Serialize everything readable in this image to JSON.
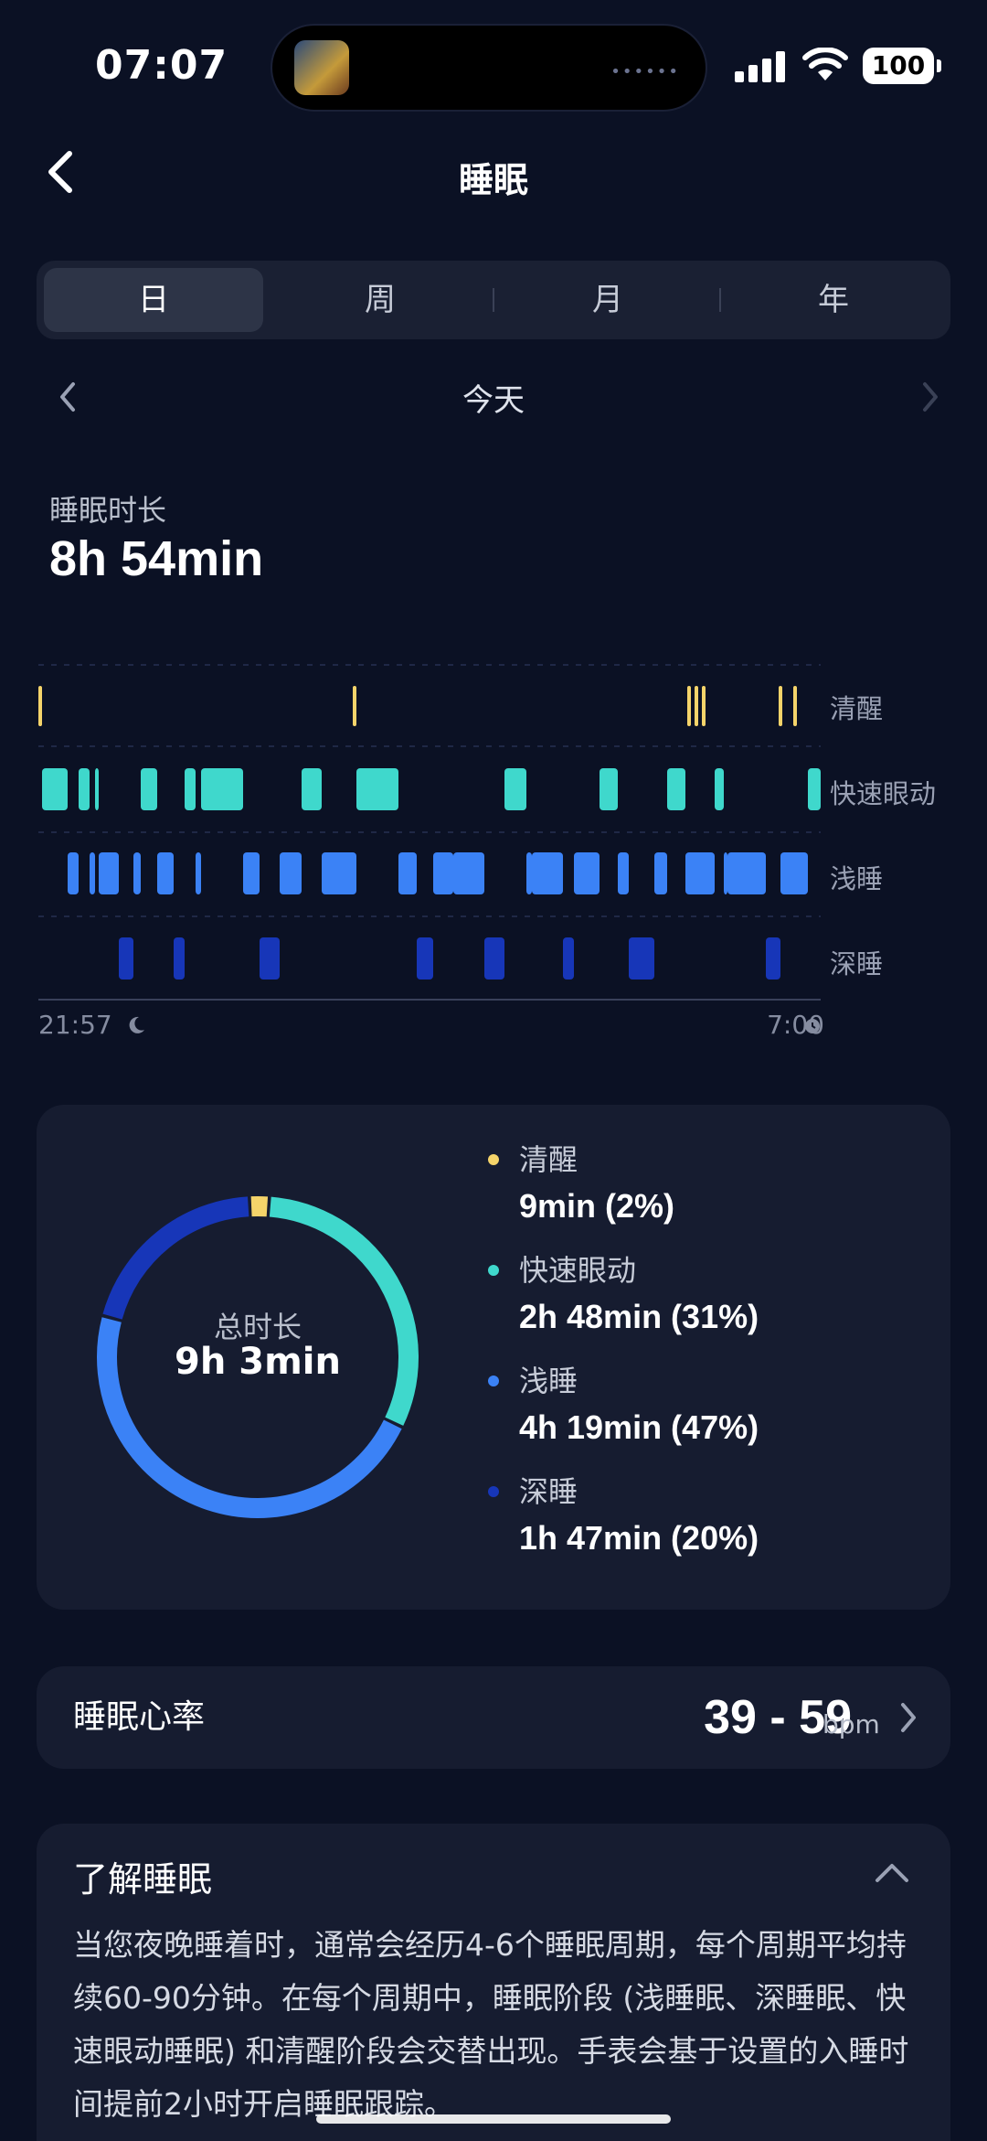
{
  "status_bar": {
    "time": "07:07",
    "battery": "100"
  },
  "header": {
    "title": "睡眠"
  },
  "tabs": [
    {
      "label": "日",
      "active": true
    },
    {
      "label": "周",
      "active": false
    },
    {
      "label": "月",
      "active": false
    },
    {
      "label": "年",
      "active": false
    }
  ],
  "date_nav": {
    "label": "今天"
  },
  "duration": {
    "label": "睡眠时长",
    "value": "8h 54min"
  },
  "chart_data": {
    "type": "sleep-stage-timeline",
    "stages": [
      "清醒",
      "快速眼动",
      "浅睡",
      "深睡"
    ],
    "start_label": "21:57",
    "end_label": "7:00",
    "stage_colors": {
      "清醒": "#f5d46a",
      "快速眼动": "#3fd8cc",
      "浅睡": "#3b82f6",
      "深睡": "#1736b8"
    }
  },
  "summary": {
    "total_label": "总时长",
    "total_value": "9h 3min",
    "legend": [
      {
        "name": "清醒",
        "value": "9min (2%)",
        "percent": 2,
        "color": "#f5d46a"
      },
      {
        "name": "快速眼动",
        "value": "2h 48min (31%)",
        "percent": 31,
        "color": "#3fd8cc"
      },
      {
        "name": "浅睡",
        "value": "4h 19min (47%)",
        "percent": 47,
        "color": "#3b82f6"
      },
      {
        "name": "深睡",
        "value": "1h 47min (20%)",
        "percent": 20,
        "color": "#1736b8"
      }
    ]
  },
  "heart_rate": {
    "label": "睡眠心率",
    "value": "39 - 59",
    "unit": "bpm"
  },
  "info": {
    "title": "了解睡眠",
    "body": "当您夜晚睡着时，通常会经历4-6个睡眠周期，每个周期平均持续60-90分钟。在每个周期中，睡眠阶段 (浅睡眠、深睡眠、快速眼动睡眠) 和清醒阶段会交替出现。手表会基于设置的入睡时间提前2小时开启睡眠跟踪。"
  }
}
